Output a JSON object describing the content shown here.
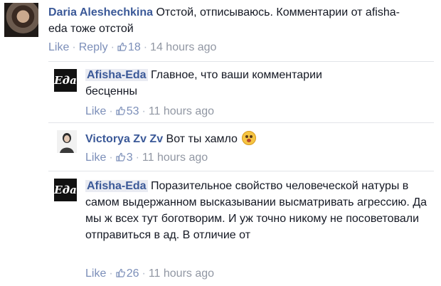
{
  "comments": [
    {
      "author": "Daria Aleshechkina",
      "text": "Отстой, отписываюсь. Комментарии от afisha-eda тоже отстой",
      "actions": {
        "like": "Like",
        "reply": "Reply"
      },
      "likes": "18",
      "time": "14 hours ago"
    }
  ],
  "replies": [
    {
      "author": "Afisha-Eda",
      "avatar_text": "Eда",
      "text": "Главное, что ваши комментарии бесценны",
      "like": "Like",
      "likes": "53",
      "time": "11 hours ago"
    },
    {
      "author": "Victorya Zv Zv",
      "text": "Вот ты хамло",
      "like": "Like",
      "likes": "3",
      "time": "11 hours ago",
      "emoji_icon": "surprised-face-icon"
    },
    {
      "author": "Afisha-Eda",
      "avatar_text": "Eда",
      "text": "Поразительное свойство человеческой натуры в самом выдержанном высказывании высматривать агрессию. Да мы ж всех тут боготворим. И уж точно никому не посоветовали отправиться в ад. В отличие от",
      "like": "Like",
      "likes": "26",
      "time": "11 hours ago"
    }
  ],
  "colors": {
    "author_link": "#3b5998",
    "meta_link": "#7c8fb9",
    "time": "#9197a3",
    "divider": "#e2e4e9"
  }
}
